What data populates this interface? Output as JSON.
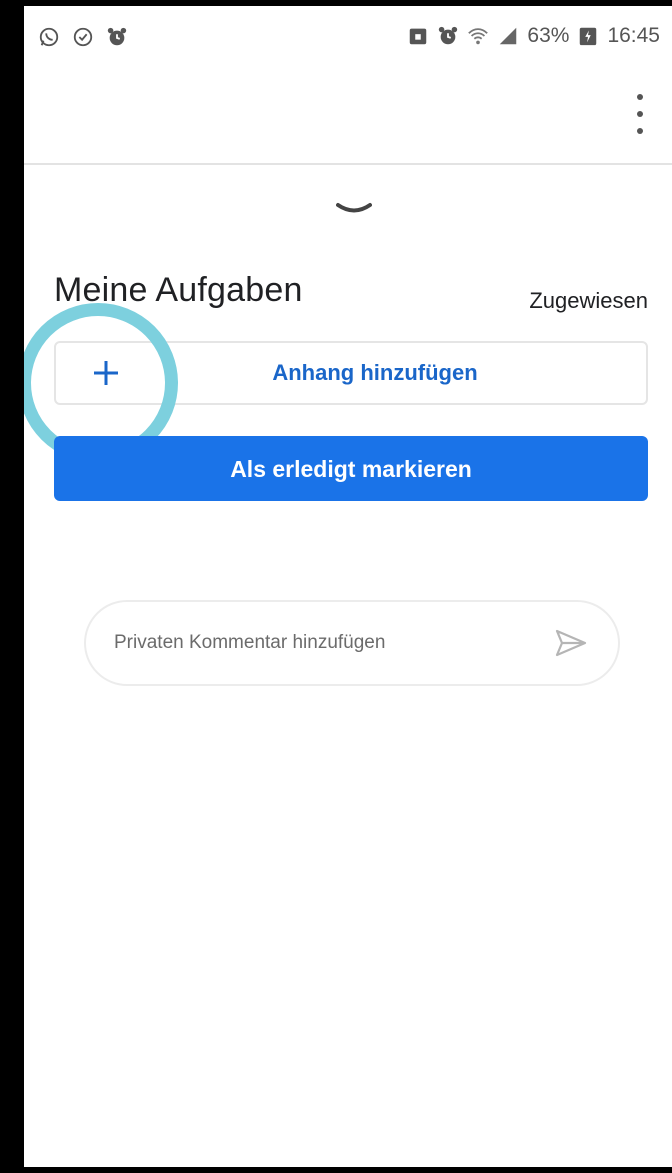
{
  "status_bar": {
    "icons_left": [
      "whatsapp-icon",
      "shield-check-icon",
      "alarm-icon"
    ],
    "icons_right": [
      "lock-icon",
      "alarm-icon",
      "wifi-icon",
      "signal-icon"
    ],
    "battery_percent": "63%",
    "time": "16:45"
  },
  "appbar": {
    "menu_icon": "more-vert-icon"
  },
  "task": {
    "title": "Meine Aufgaben",
    "status": "Zugewiesen",
    "attach_label": "Anhang hinzufügen",
    "mark_done_label": "Als erledigt markieren"
  },
  "comment": {
    "placeholder": "Privaten Kommentar hinzufügen"
  },
  "colors": {
    "accent": "#1a73e8",
    "link": "#1a66c9",
    "highlight_ring": "#7dd0de"
  }
}
